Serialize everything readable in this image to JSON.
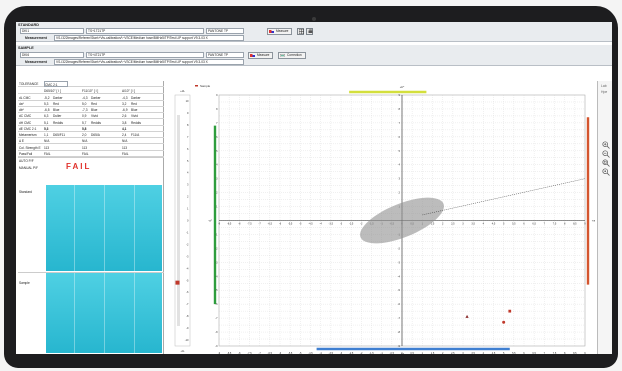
{
  "standard": {
    "title": "STANDARD",
    "name": "DKI1",
    "code": "TS+1T21TP",
    "pantone": "PANTONE TP",
    "measure_label": "Measure",
    "measurement_label": "Measurement",
    "measurement_path": "VS-I322Images/Referen\\Stan\\+Vts-calibration/\\~VSCE/Medium hose/8MHz5\\TP/Test LIP support V9.3-03 X"
  },
  "sample": {
    "title": "SAMPLE",
    "name": "DKI6",
    "code": "TS+4T21TP",
    "pantone": "PANTONE TP",
    "measure_label": "Measure",
    "correction_label": "Correction",
    "measurement_label": "Measurement",
    "measurement_path": "VS-I322Images/Referen\\Stan\\+Vts-calibration/\\~VSCE/Medium hose/8MHz5\\TP/Test LIP support V9.3-03 X"
  },
  "tolerance": {
    "label": "TOLERANCE",
    "value": "CMC 2:1"
  },
  "table": {
    "headers": [
      "",
      "D65/10° [ I ]",
      "F11/10° [ I ]",
      "A/10° [ I ]"
    ],
    "rows": [
      [
        "dL CMC",
        "-5,2",
        "Darker",
        "-4,3",
        "Darker",
        "-4,3",
        "Darker"
      ],
      [
        "da*",
        "5,3",
        "Red",
        "5,0",
        "Red",
        "3,2",
        "Red"
      ],
      [
        "db*",
        "-6,5",
        "Blue",
        "-7,3",
        "Blue",
        "-6,9",
        "Blue"
      ],
      [
        "dC CMC",
        "6,3",
        "Duller",
        "0,9",
        "Vivid",
        "2,6",
        "Vivid"
      ],
      [
        "dH CMC",
        "5,1",
        "Reddis",
        "5,7",
        "Reddis",
        "3,8",
        "Reddis"
      ],
      [
        "dE CMC 2:1",
        "5,3",
        "",
        "5,8",
        "",
        "4,1",
        ""
      ],
      [
        "Metamerism",
        "1,1",
        "D65/F11",
        "2,0",
        "D65/A",
        "2,4",
        "F11/A"
      ],
      [
        "Δ E",
        "N/A",
        "",
        "N/A",
        "",
        "N/A",
        ""
      ],
      [
        "Col. Strength E",
        "113",
        "",
        "113",
        "",
        "113",
        ""
      ],
      [
        "Pass/Fail",
        "FAIL",
        "",
        "FAIL",
        "",
        "FAIL",
        ""
      ],
      [
        "AUTO P/F",
        "",
        "",
        "",
        "",
        "",
        ""
      ],
      [
        "MANUAL P/F",
        "",
        "",
        "",
        "",
        "",
        ""
      ]
    ],
    "result": "FAIL",
    "standard_label": "Standard",
    "sample_label": "Sample"
  },
  "plot": {
    "legend": "Sample",
    "top_axis_label": "+b*",
    "bottom_axis_label": "-b*",
    "left_axis_label": "-a*",
    "right_axis_label": "+a*",
    "light_top": "+dL",
    "light_bottom": "-dL",
    "lightness_ticks": [
      "10",
      "9",
      "8",
      "7",
      "6",
      "5",
      "4",
      "3",
      "2",
      "1",
      "0",
      "-1",
      "-2",
      "-3",
      "-4",
      "-5",
      "-6",
      "-7",
      "-8",
      "-9",
      "-10"
    ],
    "x_ticks": [
      "-9",
      "-8,5",
      "-8",
      "-7,5",
      "-7",
      "-6,5",
      "-6",
      "-5,5",
      "-5",
      "-4,5",
      "-4",
      "-3,5",
      "-3",
      "-2,5",
      "-2",
      "-1,5",
      "-1",
      "-0,5",
      "0",
      "0,5",
      "1",
      "1,5",
      "2",
      "2,5",
      "3",
      "3,5",
      "4",
      "4,5",
      "5",
      "5,5",
      "6",
      "6,5",
      "7",
      "7,5",
      "8",
      "8,5",
      "9"
    ],
    "y_ticks": [
      "9",
      "8",
      "7",
      "6",
      "5",
      "4",
      "3",
      "2",
      "1",
      "0",
      "-1",
      "-2",
      "-3",
      "-4",
      "-5",
      "-6",
      "-7",
      "-8",
      "-9"
    ],
    "colors": {
      "sample": "#c0392b",
      "ellipse": "#8f8f8f",
      "green": "#2e9d3d",
      "yellow": "#d3df3c",
      "blue": "#3f7fd1",
      "red": "#d4552e"
    }
  },
  "chart_data": {
    "type": "scatter",
    "x_label": "a*",
    "y_label": "b*",
    "xlim": [
      -9,
      9
    ],
    "ylim": [
      -9,
      9
    ],
    "tolerance_ellipse": {
      "center": [
        0,
        0
      ],
      "rx": 2.2,
      "ry": 1.2
    },
    "series": [
      {
        "name": "Sample",
        "points": [
          [
            5.3,
            -6.5
          ],
          [
            5.0,
            -7.3
          ],
          [
            3.2,
            -6.9
          ],
          [
            9.0,
            3.0
          ]
        ]
      }
    ],
    "lightness": {
      "dL": -5.2
    }
  },
  "right_panel": {
    "label1": "Lab",
    "label2": "Hpe",
    "zoom_icons": [
      "zoom-in-icon",
      "zoom-out-icon",
      "zoom-fit-icon",
      "zoom-reset-icon"
    ]
  }
}
